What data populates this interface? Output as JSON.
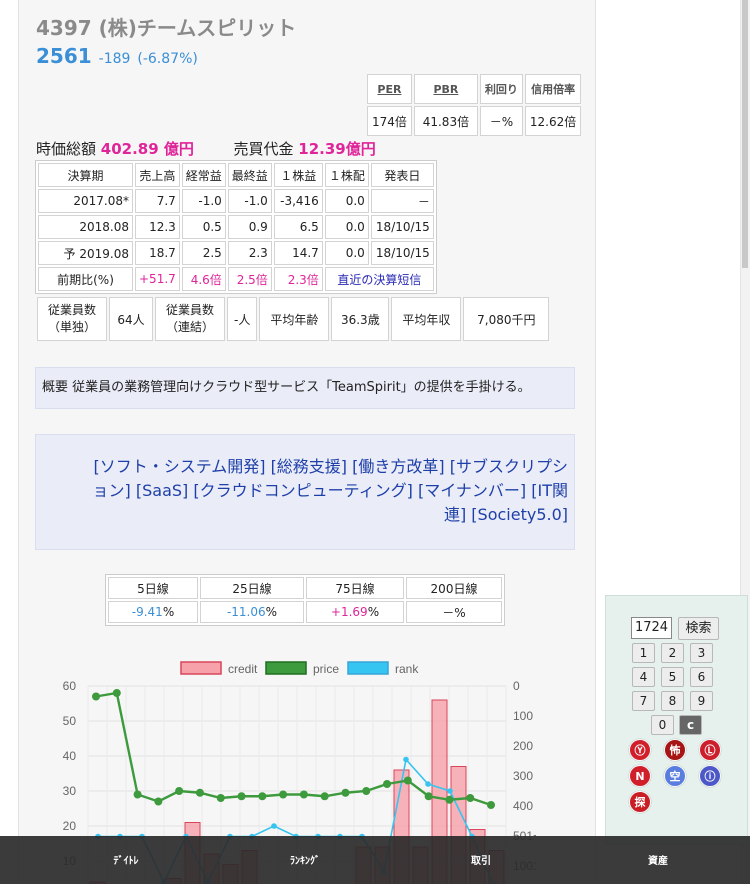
{
  "header": {
    "title": "4397 (株)チームスピリット",
    "price": "2561",
    "change": "-189",
    "change_pct": "(-6.87%)"
  },
  "ratios": {
    "headers": [
      "PER",
      "PBR",
      "利回り",
      "信用倍率"
    ],
    "values": [
      "174倍",
      "41.83倍",
      "－%",
      "12.62倍"
    ]
  },
  "market": {
    "cap_label": "時価総額",
    "cap_value": "402.89 億円",
    "volume_label": "売買代金",
    "volume_value": "12.39億円"
  },
  "performance": {
    "headers": [
      "決算期",
      "売上高",
      "経常益",
      "最終益",
      "１株益",
      "１株配",
      "発表日"
    ],
    "rows": [
      [
        "2017.08*",
        "7.7",
        "-1.0",
        "-1.0",
        "-3,416",
        "0.0",
        "－"
      ],
      [
        "2018.08",
        "12.3",
        "0.5",
        "0.9",
        "6.5",
        "0.0",
        "18/10/15"
      ],
      [
        "予 2019.08",
        "18.7",
        "2.5",
        "2.3",
        "14.7",
        "0.0",
        "18/10/15"
      ]
    ],
    "compare": [
      "前期比(%)",
      "+51.7",
      "4.6倍",
      "2.5倍",
      "2.3倍",
      "直近の決算短信"
    ]
  },
  "employees": {
    "single_label_1": "従業員数",
    "single_label_2": "（単独）",
    "single_value": "64人",
    "consol_label_1": "従業員数",
    "consol_label_2": "（連結）",
    "consol_value": "-人",
    "age_label": "平均年齢",
    "age_value": "36.3歳",
    "income_label": "平均年収",
    "income_value": "7,080千円"
  },
  "summary": "概要 従業員の業務管理向けクラウド型サービス「TeamSpirit」の提供を手掛ける。",
  "tags": [
    "[ソフト・システム開発]",
    "[総務支援]",
    "[働き方改革]",
    "[サブスクリプション]",
    "[SaaS]",
    "[クラウドコンピューティング]",
    "[マイナンバー]",
    "[IT関連]",
    "[Society5.0]"
  ],
  "moving_avg": {
    "headers": [
      "5日線",
      "25日線",
      "75日線",
      "200日線"
    ],
    "values": [
      "-9.41",
      "-11.06",
      "+1.69",
      "－"
    ],
    "unit": "%"
  },
  "chart_data": {
    "type": "bar+line",
    "legend": [
      "credit",
      "price",
      "rank"
    ],
    "legend_position": "top",
    "colors": {
      "credit": "#f7a1aa",
      "credit_border": "#d9455a",
      "price": "#3d9a3d",
      "rank": "#36c5f0"
    },
    "left_axis": {
      "ticks": [
        "60",
        "50",
        "40",
        "30",
        "20",
        "10"
      ],
      "ylim": [
        0,
        60
      ]
    },
    "right_axis": {
      "ticks": [
        "0",
        "100",
        "200",
        "300",
        "400",
        "501~",
        "1001~"
      ]
    },
    "grid": true,
    "credit": [
      4,
      3,
      3,
      3,
      5,
      21,
      12,
      9,
      13,
      3,
      3,
      2,
      3,
      3,
      14,
      14,
      36,
      14,
      56,
      37,
      19,
      13
    ],
    "price": [
      57,
      58,
      29,
      27,
      30,
      29.5,
      28,
      28.5,
      28.5,
      29,
      29,
      28.5,
      29.5,
      30,
      32,
      33,
      28.5,
      27.5,
      28,
      26
    ],
    "rank": [
      17,
      17,
      17,
      4,
      17,
      4,
      17,
      17,
      20,
      17,
      17,
      17,
      17,
      7,
      39,
      32,
      30,
      17,
      3
    ]
  },
  "code_panel": {
    "code_value": "1724",
    "search_label": "検索",
    "keys": [
      "1",
      "2",
      "3",
      "4",
      "5",
      "6",
      "7",
      "8",
      "9",
      "0",
      "c"
    ],
    "circle_icons": [
      {
        "label": "Ⓨ",
        "name": "yahoo-icon",
        "color": "#d01f2a"
      },
      {
        "label": "怖",
        "name": "fear-icon",
        "color": "#a61414"
      },
      {
        "label": "Ⓛ",
        "name": "link-icon",
        "color": "#cc1f2b"
      },
      {
        "label": "N",
        "name": "news-icon",
        "color": "#d01f2a"
      },
      {
        "label": "空",
        "name": "short-icon",
        "color": "#5a7de0"
      },
      {
        "label": "ⓘ",
        "name": "info-icon",
        "color": "#4d58c8"
      },
      {
        "label": "探",
        "name": "search-circle-icon",
        "color": "#c81e24"
      }
    ]
  },
  "nav": [
    "ﾃﾞｲﾄﾚ",
    "ﾗﾝｷﾝｸﾞ",
    "取引",
    "資産"
  ]
}
